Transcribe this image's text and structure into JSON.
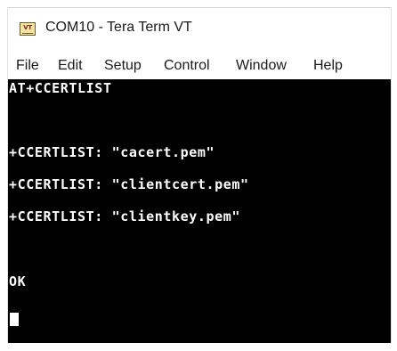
{
  "window": {
    "title": "COM10 - Tera Term VT",
    "icon_label": "VT",
    "icon": "tera-term-app-icon"
  },
  "menu": {
    "items": [
      {
        "label": "File"
      },
      {
        "label": "Edit"
      },
      {
        "label": "Setup"
      },
      {
        "label": "Control"
      },
      {
        "label": "Window"
      },
      {
        "label": "Help"
      }
    ]
  },
  "terminal": {
    "background": "#000000",
    "foreground": "#ffffff",
    "lines": [
      "AT+CCERTLIST",
      "",
      "",
      "+CCERTLIST: \"cacert.pem\"",
      "",
      "+CCERTLIST: \"clientcert.pem\"",
      "",
      "+CCERTLIST: \"clientkey.pem\"",
      "",
      "",
      "OK"
    ]
  }
}
